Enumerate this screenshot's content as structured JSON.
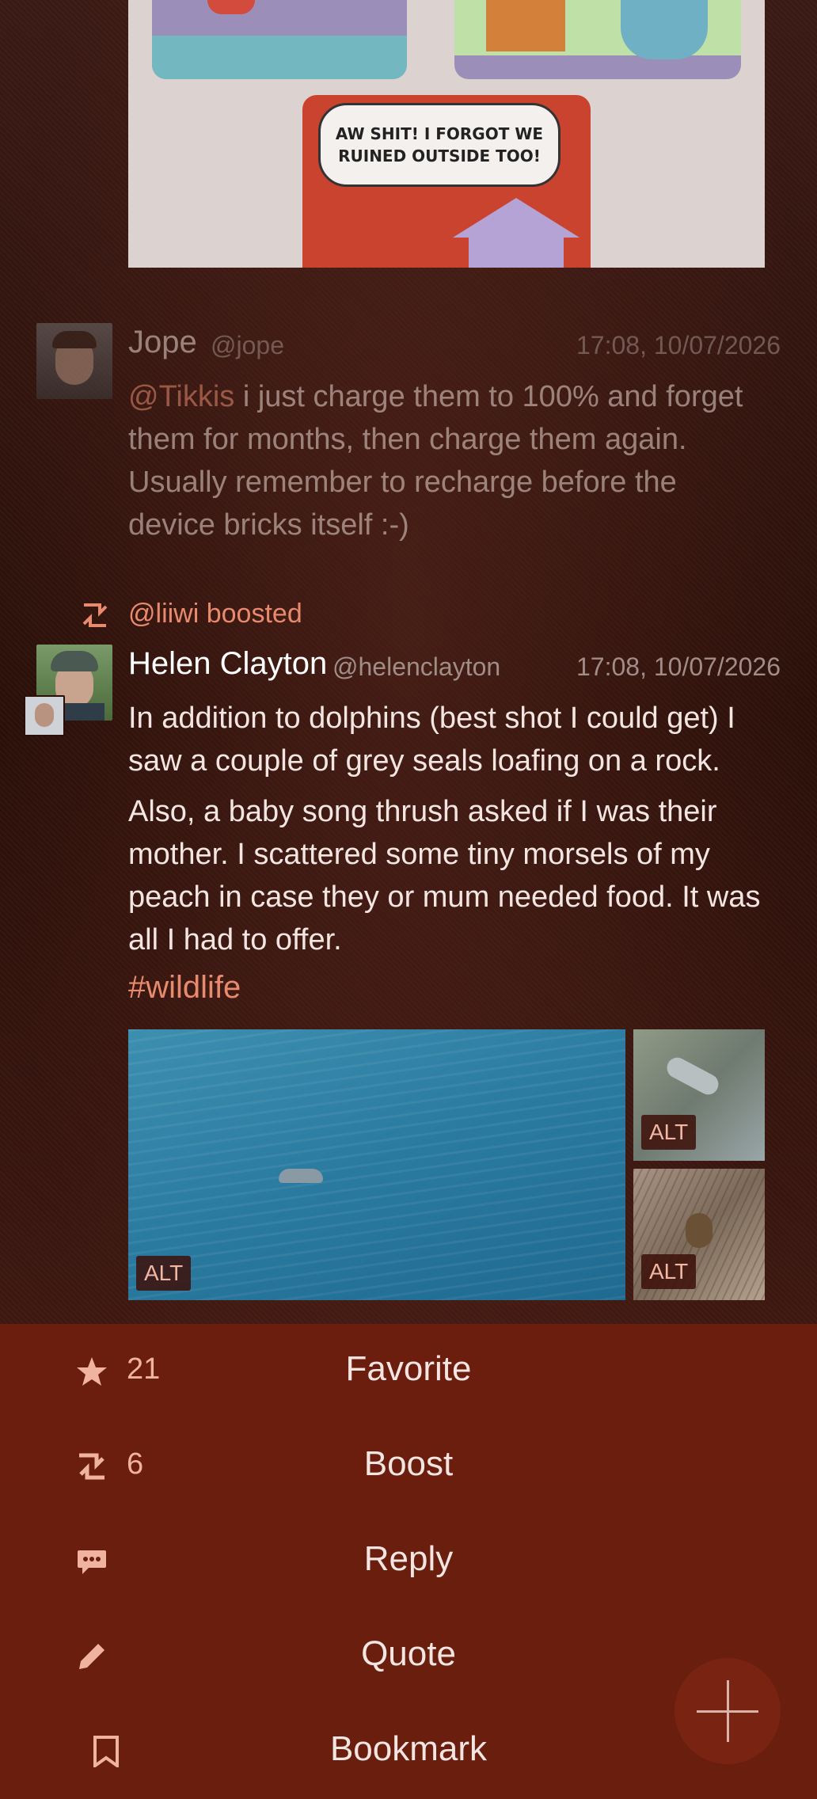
{
  "comic": {
    "bubble_text": "AW SHIT! I FORGOT WE RUINED OUTSIDE TOO!"
  },
  "posts": [
    {
      "name": "Jope",
      "handle": "@jope",
      "time": "17:08, 10/07/2026",
      "mention": "@Tikkis",
      "text": " i just charge them to 100% and forget them for months, then charge them again. Usually remember to recharge before the device bricks itself :-)"
    },
    {
      "boosted_by": "@liiwi boosted",
      "name": "Helen Clayton",
      "handle": "@helenclayton",
      "time": "17:08, 10/07/2026",
      "paragraph1": "In addition to dolphins (best shot I could get) I saw a couple of grey seals loafing on a rock.",
      "paragraph2": "Also, a baby song thrush asked if I was their mother. I scattered some tiny morsels of my peach in case they or mum needed food. It was all I had to offer.",
      "hashtag": "#wildlife",
      "media_alt_badge": "ALT"
    }
  ],
  "menu": {
    "favorite": {
      "count": "21",
      "label": "Favorite",
      "icon": "star-icon"
    },
    "boost": {
      "count": "6",
      "label": "Boost",
      "icon": "boost-icon"
    },
    "reply": {
      "label": "Reply",
      "icon": "reply-icon"
    },
    "quote": {
      "label": "Quote",
      "icon": "pencil-icon"
    },
    "bookmark": {
      "label": "Bookmark",
      "icon": "bookmark-icon"
    }
  },
  "colors": {
    "accent": "#e88a6e",
    "menu_bg": "#6b1e0e"
  }
}
